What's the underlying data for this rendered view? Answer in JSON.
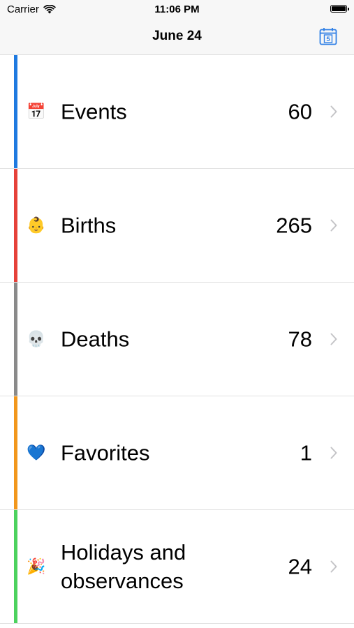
{
  "status_bar": {
    "carrier": "Carrier",
    "time": "11:06 PM",
    "wifi_icon": "wifi-icon",
    "battery_icon": "battery-icon",
    "battery_level": 1.0
  },
  "nav": {
    "title": "June 24",
    "calendar_icon": "calendar-icon",
    "calendar_day": "5",
    "accent_color": "#2f7fe6"
  },
  "rows": [
    {
      "label": "Events",
      "count": "60",
      "icon": "calendar-17-icon",
      "glyph": "📅",
      "bar_color": "#1f7ae0"
    },
    {
      "label": "Births",
      "count": "265",
      "icon": "baby-icon",
      "glyph": "👶",
      "bar_color": "#e6413a"
    },
    {
      "label": "Deaths",
      "count": "78",
      "icon": "skull-icon",
      "glyph": "💀",
      "bar_color": "#8a8a8a"
    },
    {
      "label": "Favorites",
      "count": "1",
      "icon": "blue-heart-icon",
      "glyph": "💙",
      "bar_color": "#f2971c"
    },
    {
      "label": "Holidays and observances",
      "count": "24",
      "icon": "party-popper-icon",
      "glyph": "🎉",
      "bar_color": "#4cd25e"
    }
  ]
}
